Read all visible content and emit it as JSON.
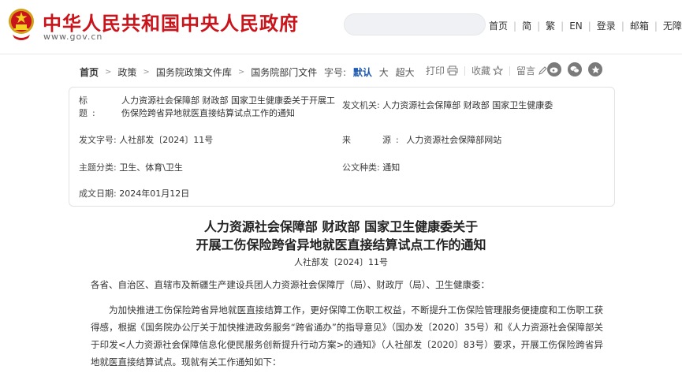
{
  "site": {
    "title": "中华人民共和国中央人民政府",
    "domain": "www.gov.cn"
  },
  "search": {
    "placeholder": ""
  },
  "top_links": [
    "首页",
    "简",
    "繁",
    "EN",
    "登录",
    "邮箱",
    "无障碍"
  ],
  "breadcrumb": [
    "首页",
    "政策",
    "国务院政策文件库",
    "国务院部门文件"
  ],
  "font_size": {
    "label": "字号:",
    "options": [
      "默认",
      "大",
      "超大"
    ],
    "active": "默认"
  },
  "tools": {
    "print": "打印",
    "favorite": "收藏",
    "comment": "留言"
  },
  "share_icons": [
    "weibo-icon",
    "wechat-icon",
    "qzone-icon"
  ],
  "meta": {
    "title_label": "标　　题:",
    "title_value": "人力资源社会保障部 财政部 国家卫生健康委关于开展工伤保险跨省异地就医直接结算试点工作的通知",
    "issuer_label": "发文机关:",
    "issuer_value": "人力资源社会保障部 财政部 国家卫生健康委",
    "doc_no_label": "发文字号:",
    "doc_no_value": "人社部发〔2024〕11号",
    "source_label": "来　　源:",
    "source_value": "人力资源社会保障部网站",
    "category_label": "主题分类:",
    "category_value": "卫生、体育\\卫生",
    "type_label": "公文种类:",
    "type_value": "通知",
    "date_label": "成文日期:",
    "date_value": "2024年01月12日"
  },
  "doc": {
    "title_line1": "人力资源社会保障部 财政部 国家卫生健康委关于",
    "title_line2": "开展工伤保险跨省异地就医直接结算试点工作的通知",
    "number": "人社部发〔2024〕11号",
    "salutation": "各省、自治区、直辖市及新疆生产建设兵团人力资源社会保障厅（局）、财政厅（局）、卫生健康委：",
    "para1": "为加快推进工伤保险跨省异地就医直接结算工作，更好保障工伤职工权益，不断提升工伤保险管理服务便捷度和工伤职工获得感，根据《国务院办公厅关于加快推进政务服务“跨省通办”的指导意见》（国办发〔2020〕35号）和《人力资源社会保障部关于印发<人力资源社会保障信息化便民服务创新提升行动方案>的通知》（人社部发〔2020〕83号）要求，开展工伤保险跨省异地就医直接结算试点。现就有关工作通知如下："
  },
  "colors": {
    "brand_red": "#c8141a",
    "link_blue": "#1a56b0"
  }
}
